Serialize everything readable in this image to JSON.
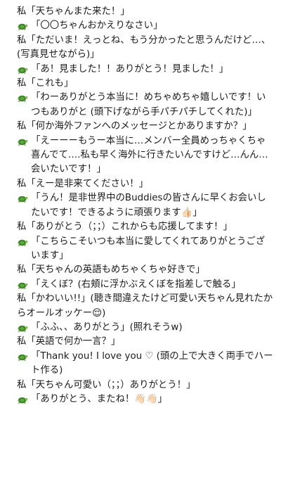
{
  "speaker_icon": "turtle-icon",
  "lines": [
    {
      "turtle": false,
      "text": "私「天ちゃんまた来た！」"
    },
    {
      "turtle": true,
      "text": "「〇〇ちゃんおかえりなさい」"
    },
    {
      "turtle": false,
      "text": "私「ただいま！えっとね、もう分かったと思うんだけど…、(写真見せながら)」"
    },
    {
      "turtle": true,
      "text": "「あ！見ました！！ありがとう！見ました！」"
    },
    {
      "turtle": false,
      "text": "私「これも」"
    },
    {
      "turtle": true,
      "text": "「わーありがとう本当に！めちゃめちゃ嬉しいです！いつもありがと (頭下げながら手パチパチしてくれた)」"
    },
    {
      "turtle": false,
      "text": "私「何か海外ファンへのメッセージとかありますか？」"
    },
    {
      "turtle": true,
      "text": "「えーーーもうー本当に…メンバー全員めっちゃくちゃ喜んでて….私も早く海外に行きたいんですけど…んん…会いたいです！」"
    },
    {
      "turtle": false,
      "text": "私「えー是非来てください！」"
    },
    {
      "turtle": true,
      "text": "「うん！是非世界中のBuddiesの皆さんに早くお会いしたいです！できるように頑張ります👍🏻」"
    },
    {
      "turtle": false,
      "text": "私「ありがとう（；；）これからも応援してます！」"
    },
    {
      "turtle": true,
      "text": "「こちらこそいつも本当に愛してくれてありがとうございます」"
    },
    {
      "turtle": false,
      "text": "私「天ちゃんの英語もめちゃくちゃ好きで」"
    },
    {
      "turtle": true,
      "text": "「えくぼ？(右頬に浮かぶえくぼを指差しで触る」"
    },
    {
      "turtle": false,
      "text": "私「かわいい!!」(聴き間違えたけど可愛い天ちゃん見れたからオールオッケー😌)"
    },
    {
      "turtle": true,
      "text": "「ふふ、、ありがとう」(照れそうw)"
    },
    {
      "turtle": false,
      "text": "私「英語で何か一言？」"
    },
    {
      "turtle": true,
      "text": "「Thank you! I love you ♡ (頭の上で大きく両手でハート作る)"
    },
    {
      "turtle": false,
      "text": "私「天ちゃん可愛い（；；）ありがとう！」"
    },
    {
      "turtle": true,
      "text": "「ありがとう、またね！👋🏻👋🏻」"
    }
  ]
}
